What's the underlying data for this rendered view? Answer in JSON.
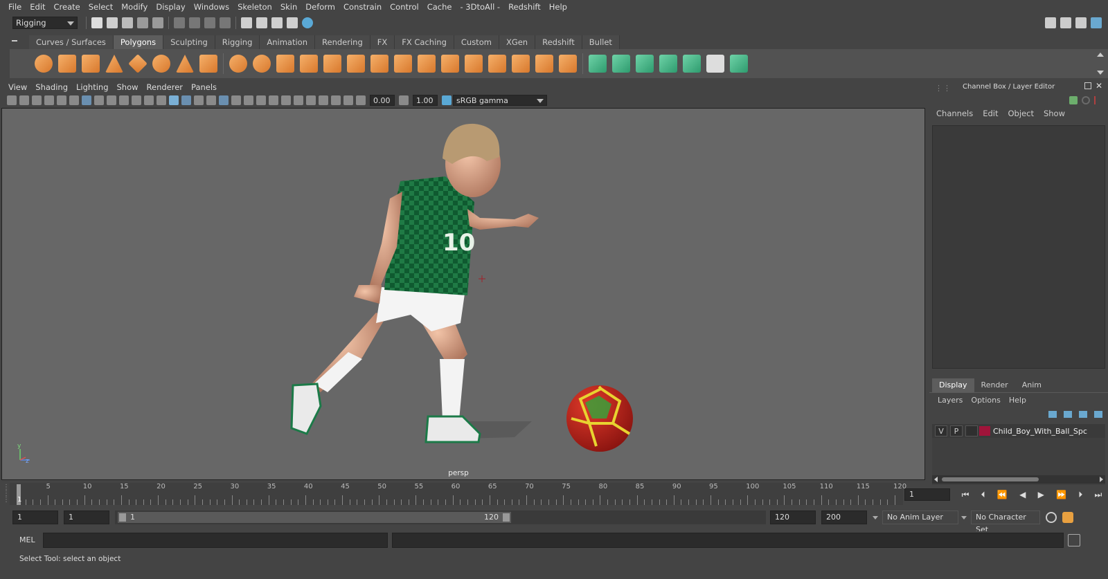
{
  "menu": [
    "File",
    "Edit",
    "Create",
    "Select",
    "Modify",
    "Display",
    "Windows",
    "Skeleton",
    "Skin",
    "Deform",
    "Constrain",
    "Control",
    "Cache",
    "- 3DtoAll -",
    "Redshift",
    "Help"
  ],
  "workspace_select": "Rigging",
  "shelf_tabs": [
    "Curves / Surfaces",
    "Polygons",
    "Sculpting",
    "Rigging",
    "Animation",
    "Rendering",
    "FX",
    "FX Caching",
    "Custom",
    "XGen",
    "Redshift",
    "Bullet"
  ],
  "active_shelf_tab": "Polygons",
  "panel_menu": [
    "View",
    "Shading",
    "Lighting",
    "Show",
    "Renderer",
    "Panels"
  ],
  "viewport": {
    "exposure": "0.00",
    "gamma": "1.00",
    "color_space": "sRGB gamma",
    "camera_label": "persp",
    "axis_y": "y",
    "axis_z": "z",
    "jersey_number": "10"
  },
  "channel_box": {
    "title": "Channel Box / Layer Editor",
    "menu": [
      "Channels",
      "Edit",
      "Object",
      "Show"
    ]
  },
  "layer_editor": {
    "tabs": [
      "Display",
      "Render",
      "Anim"
    ],
    "active_tab": "Display",
    "menu": [
      "Layers",
      "Options",
      "Help"
    ],
    "layer": {
      "v": "V",
      "p": "P",
      "name": "Child_Boy_With_Ball_Spc",
      "color": "#a0143a"
    }
  },
  "timeline": {
    "ticks": [
      "5",
      "10",
      "15",
      "20",
      "25",
      "30",
      "35",
      "40",
      "45",
      "50",
      "55",
      "60",
      "65",
      "70",
      "75",
      "80",
      "85",
      "90",
      "95",
      "100",
      "105",
      "110",
      "115",
      "120"
    ],
    "current_frame_marker": "1",
    "current_frame": "1"
  },
  "range": {
    "start": "1",
    "anim_start": "1",
    "slider_start": "1",
    "slider_end": "120",
    "end": "120",
    "anim_end": "200",
    "anim_layer": "No Anim Layer",
    "character_set": "No Character Set"
  },
  "command_line": {
    "label": "MEL"
  },
  "help_line": "Select Tool: select an object",
  "colors": {
    "accent_blue": "#5285a6",
    "viewport_bg": "#676767",
    "shelf_orange": "#e89040",
    "shelf_green": "#4cb88a"
  }
}
